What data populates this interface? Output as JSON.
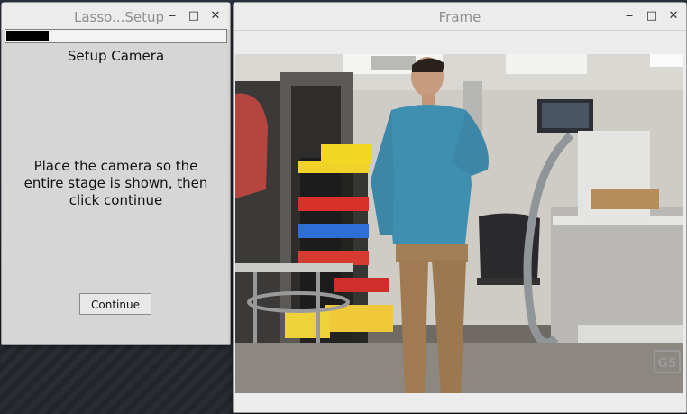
{
  "setup_window": {
    "title": "Lasso...Setup",
    "progress": 0.19,
    "heading": "Setup Camera",
    "instructions": "Place the camera so the entire stage is shown, then click continue",
    "continue_label": "Continue"
  },
  "frame_window": {
    "title": "Frame",
    "badge": "G5"
  },
  "window_controls": {
    "minimize": "‒",
    "maximize": "□",
    "close": "✕"
  }
}
